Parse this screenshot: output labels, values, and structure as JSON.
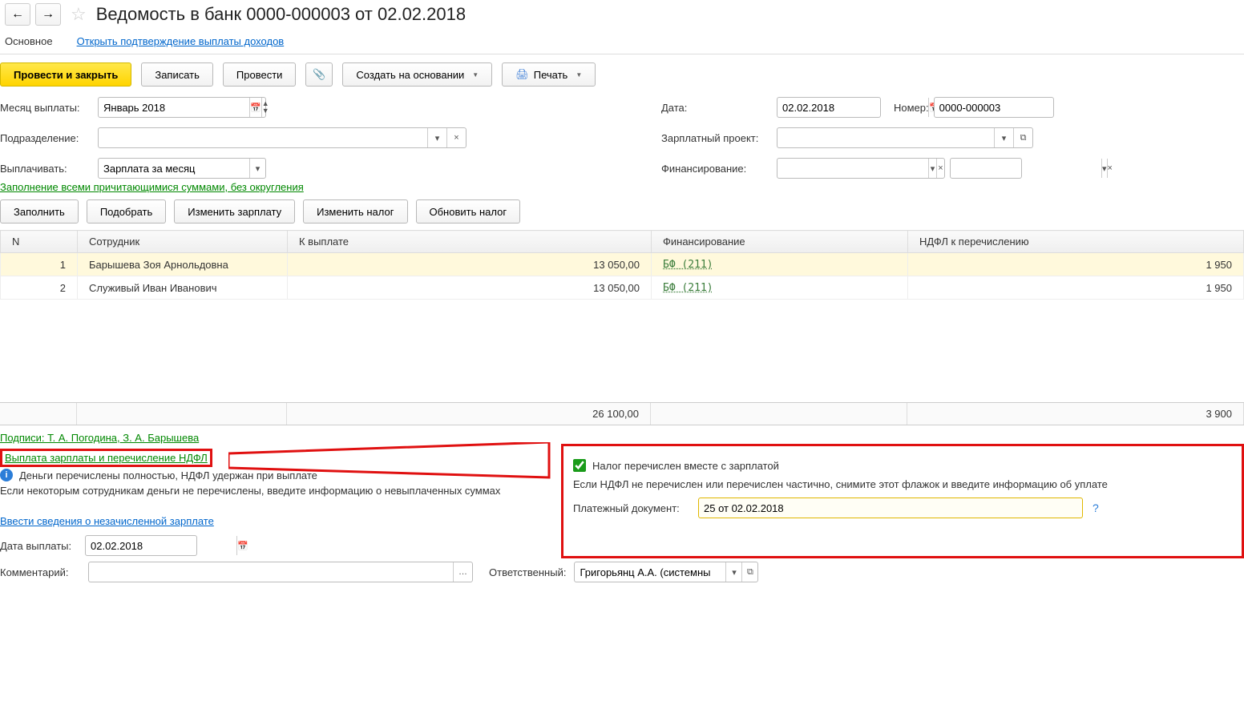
{
  "header": {
    "title": "Ведомость в банк 0000-000003 от 02.02.2018"
  },
  "tabs": {
    "main": "Основное",
    "open_confirm": "Открыть подтверждение выплаты доходов"
  },
  "toolbar": {
    "post_close": "Провести и закрыть",
    "save": "Записать",
    "post": "Провести",
    "create_based": "Создать на основании",
    "print": "Печать"
  },
  "form": {
    "month_lbl": "Месяц выплаты:",
    "month_val": "Январь 2018",
    "dept_lbl": "Подразделение:",
    "dept_val": "",
    "paytype_lbl": "Выплачивать:",
    "paytype_val": "Зарплата за месяц",
    "date_lbl": "Дата:",
    "date_val": "02.02.2018",
    "number_lbl": "Номер:",
    "number_val": "0000-000003",
    "salproj_lbl": "Зарплатный проект:",
    "salproj_val": "",
    "finance_lbl": "Финансирование:",
    "fill_link": "Заполнение всеми причитающимися суммами, без округления"
  },
  "table_btns": {
    "fill": "Заполнить",
    "pick": "Подобрать",
    "chg_salary": "Изменить зарплату",
    "chg_tax": "Изменить налог",
    "upd_tax": "Обновить налог"
  },
  "grid": {
    "cols": {
      "n": "N",
      "emp": "Сотрудник",
      "pay": "К выплате",
      "fin": "Финансирование",
      "tax": "НДФЛ к перечислению"
    },
    "rows": [
      {
        "n": "1",
        "emp": "Барышева Зоя Арнольдовна",
        "pay": "13 050,00",
        "fin": "БФ (211)",
        "tax": "1 950"
      },
      {
        "n": "2",
        "emp": "Служивый Иван Иванович",
        "pay": "13 050,00",
        "fin": "БФ (211)",
        "tax": "1 950"
      }
    ],
    "totals": {
      "pay": "26 100,00",
      "tax": "3 900"
    }
  },
  "footer": {
    "signatures": "Подписи: Т. А. Погодина, З. А. Барышева",
    "payout_link": "Выплата зарплаты и перечисление НДФЛ",
    "info_text": "Деньги перечислены полностью, НДФЛ удержан при выплате",
    "note": "Если некоторым сотрудникам деньги не перечислены, введите информацию о невыплаченных суммах",
    "enter_unpaid": "Ввести сведения о незачисленной зарплате",
    "paydate_lbl": "Дата выплаты:",
    "paydate_val": "02.02.2018",
    "comment_lbl": "Комментарий:",
    "comment_val": "",
    "resp_lbl": "Ответственный:",
    "resp_val": "Григорьянц А.А. (системны"
  },
  "right_panel": {
    "chk_label": "Налог перечислен вместе с зарплатой",
    "note": "Если НДФЛ не перечислен или перечислен частично, снимите этот флажок и введите информацию об уплате",
    "paydoc_lbl": "Платежный документ:",
    "paydoc_val": "25 от 02.02.2018"
  }
}
